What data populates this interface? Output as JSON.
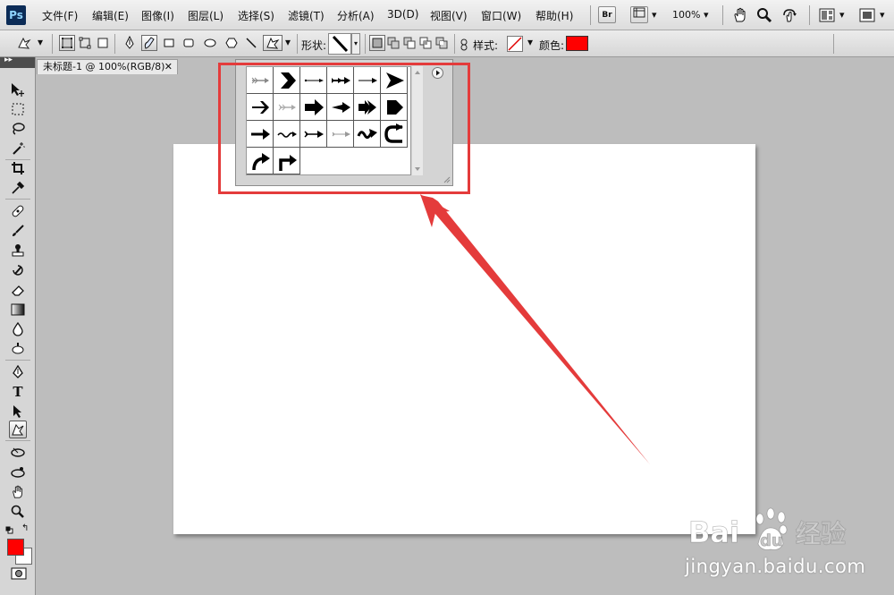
{
  "app": {
    "logo": "Ps",
    "accent": "#0c2c57"
  },
  "menu": [
    "文件(F)",
    "编辑(E)",
    "图像(I)",
    "图层(L)",
    "选择(S)",
    "滤镜(T)",
    "分析(A)",
    "3D(D)",
    "视图(V)",
    "窗口(W)",
    "帮助(H)"
  ],
  "menubar_tools": {
    "bridge_label": "Br",
    "zoom": "100%",
    "arrange_icon": "grid-icon",
    "screen_mode_icon": "screen-mode-icon"
  },
  "options": {
    "shape_label": "形状:",
    "style_label": "样式:",
    "color_label": "颜色:",
    "color_value": "#ff0000"
  },
  "document": {
    "tab_title": "未标题-1 @ 100%(RGB/8)",
    "close": "✕"
  },
  "shape_picker": {
    "shapes": [
      "arrow-feathered-thin",
      "chevron-arrow",
      "arrow-line-thin",
      "arrow-line-double-head",
      "arrow-line-plain",
      "arrowhead-large",
      "arrow-bold-line",
      "arrow-feathered-light",
      "arrow-block",
      "arrow-tapered",
      "arrow-double-block",
      "arrow-pentagon",
      "arrow-bold-line-2",
      "arrow-wavy-thin",
      "arrow-line-tail",
      "arrow-line-thin-2",
      "arrow-wavy-bold",
      "arrow-u-turn",
      "arrow-curved-right",
      "arrow-turn-right"
    ]
  },
  "colors": {
    "foreground": "#ff0000",
    "background": "#ffffff",
    "annotation": "#e43b3b"
  },
  "watermark": {
    "brand": "Bai",
    "brand2": "du",
    "brand_cn": "经验",
    "url": "jingyan.baidu.com"
  }
}
